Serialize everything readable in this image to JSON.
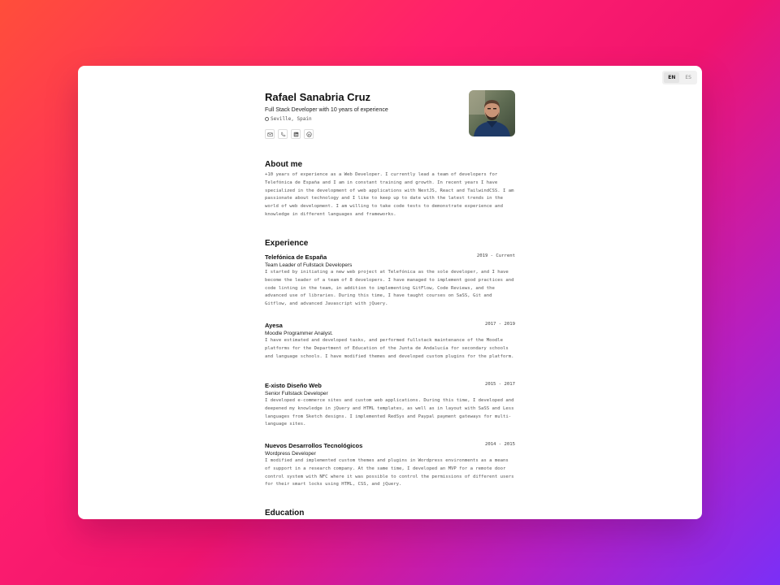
{
  "lang": {
    "en": "EN",
    "es": "ES"
  },
  "profile": {
    "name": "Rafael Sanabria Cruz",
    "role": "Full Stack Developer with 10 years of experience",
    "location": "Seville, Spain",
    "social_icons": [
      "mail-icon",
      "phone-icon",
      "linkedin-icon",
      "github-icon"
    ]
  },
  "about": {
    "title": "About me",
    "text": "+10 years of experience as a Web Developer. I currently lead a team of developers for Telefónica de España and I am in constant training and growth. In recent years I have specialized in the development of web applications with NextJS, React and TailwindCSS. I am passionate about technology and I like to keep up to date with the latest trends in the world of web development. I am willing to take code tests to demonstrate experience and knowledge in different languages and frameworks."
  },
  "experience": {
    "title": "Experience",
    "jobs": [
      {
        "company": "Telefónica de España",
        "dates": "2019 - Current",
        "role": "Team Leader of Fullstack Developers",
        "desc": "I started by initiating a new web project at Telefónica as the sole developer, and I have become the leader of a team of 8 developers. I have managed to implement good practices and code linting in the team, in addition to implementing GitFlow, Code Reviews, and the advanced use of libraries. During this time, I have taught courses on SaSS, Git and Gitflow, and advanced Javascript with jQuery."
      },
      {
        "company": "Ayesa",
        "dates": "2017 - 2019",
        "role": "Moodle Programmer Analyst.",
        "desc": "I have estimated and developed tasks, and performed fullstack maintenance of the Moodle platforms for the Department of Education of the Junta de Andalucía for secondary schools and language schools. I have modified themes and developed custom plugins for the platform."
      },
      {
        "company": "E-xisto Diseño Web",
        "dates": "2015 - 2017",
        "role": "Senior Fullstack Developer",
        "desc": "I developed e-commerce sites and custom web applications. During this time, I developed and deepened my knowledge in jQuery and HTML templates, as well as in layout with SaSS and Less languages from Sketch designs. I implemented RedSys and Paypal payment gateways for multi-language sites."
      },
      {
        "company": "Nuevos Desarrollos Tecnológicos",
        "dates": "2014 - 2015",
        "role": "Wordpress Developer",
        "desc": "I modified and implemented custom themes and plugins in Wordpress environments as a means of support in a research company. At the same time, I developed an MVP for a remote door control system with NFC where it was possible to control the permissions of different users for their smart locks using HTML, CSS, and jQuery."
      }
    ]
  },
  "education": {
    "title": "Education"
  }
}
